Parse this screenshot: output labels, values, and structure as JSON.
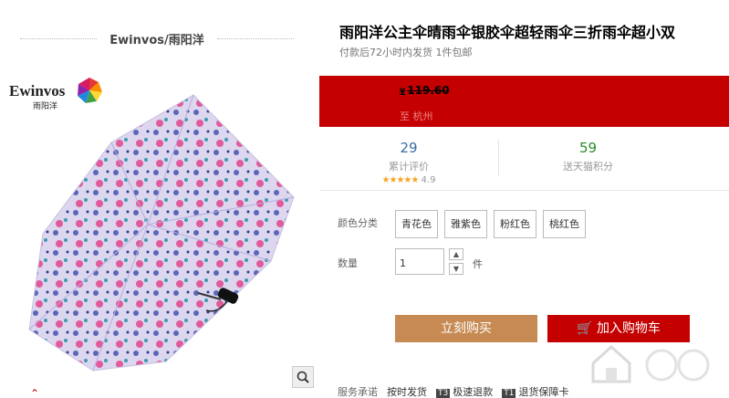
{
  "brand": {
    "name": "Ewinvos/雨阳洋",
    "logo_text": "Ewinvos",
    "logo_sub": "雨阳洋"
  },
  "product": {
    "title": "雨阳洋公主伞晴雨伞银胶伞超轻雨伞三折雨伞超小双",
    "subtitle": "付款后72小时内发货 1件包邮",
    "price_symbol": "¥",
    "price": "119.60",
    "ship_to": "至 杭州"
  },
  "stats": {
    "reviews": {
      "value": "29",
      "label": "累计评价"
    },
    "rating": {
      "stars": "★★★★★",
      "score": "4.9"
    },
    "points": {
      "value": "59",
      "label": "送天猫积分"
    }
  },
  "options": {
    "color_label": "颜色分类",
    "colors": [
      "青花色",
      "雅紫色",
      "粉红色",
      "桃红色"
    ]
  },
  "quantity": {
    "label": "数量",
    "value": "1",
    "unit": "件"
  },
  "buttons": {
    "buy_now": "立刻购买",
    "add_to_cart": "加入购物车"
  },
  "service": {
    "label": "服务承诺",
    "items": [
      "按时发货",
      "极速退款",
      "退货保障卡"
    ],
    "badges": [
      "T3",
      "T1"
    ]
  },
  "icons": [
    "zoom-icon",
    "up-arrow-icon",
    "cart-icon",
    "logo-pinwheel-icon"
  ],
  "colors": {
    "accent_red": "#c40000",
    "buy_button": "#c68a52"
  }
}
